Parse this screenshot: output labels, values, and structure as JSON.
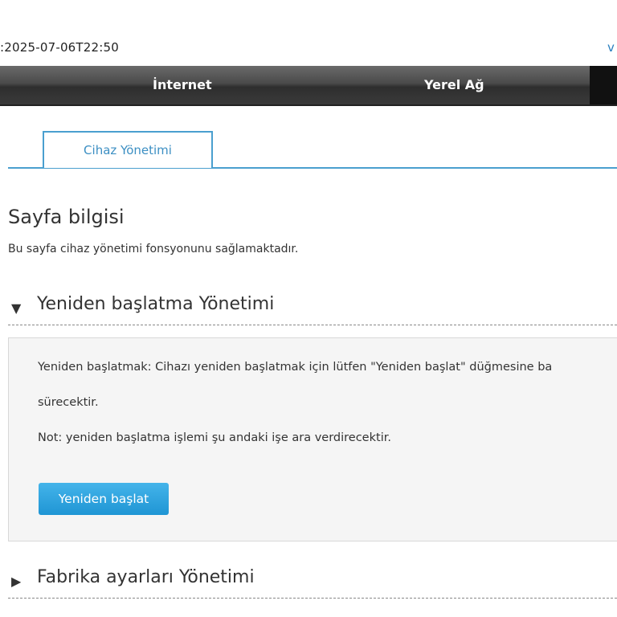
{
  "header": {
    "timestamp": ":2025-07-06T22:50",
    "corner_link": "v"
  },
  "nav": {
    "items": [
      {
        "label": "İnternet"
      },
      {
        "label": "Yerel Ağ"
      }
    ]
  },
  "tabs": [
    {
      "label": "Cihaz Yönetimi",
      "active": true
    }
  ],
  "page": {
    "title": "Sayfa bilgisi",
    "description": "Bu sayfa cihaz yönetimi fonsyonunu sağlamaktadır."
  },
  "sections": {
    "reboot": {
      "title": "Yeniden başlatma Yönetimi",
      "expanded": true,
      "line1": "Yeniden başlatmak: Cihazı yeniden başlatmak için lütfen \"Yeniden başlat\" düğmesine ba",
      "line2": "sürecektir.",
      "line3": "Not: yeniden başlatma işlemi şu andaki işe ara verdirecektir.",
      "button_label": "Yeniden başlat"
    },
    "factory": {
      "title": "Fabrika ayarları Yönetimi",
      "expanded": false
    }
  },
  "colors": {
    "accent": "#4a9fcf",
    "button": "#2aa4e0",
    "navbar": "#3a3a3a"
  }
}
